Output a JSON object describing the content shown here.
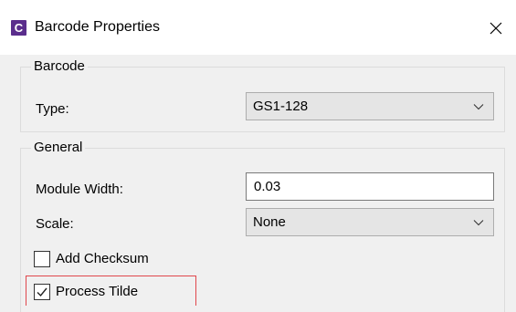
{
  "window": {
    "title": "Barcode Properties",
    "app_icon_letter": "C",
    "close_glyph": "close-icon"
  },
  "barcode_group": {
    "label": "Barcode",
    "type_label": "Type:",
    "type_value": "GS1-128"
  },
  "general_group": {
    "label": "General",
    "module_width_label": "Module Width:",
    "module_width_value": "0.03",
    "scale_label": "Scale:",
    "scale_value": "None",
    "add_checksum_label": "Add Checksum",
    "add_checksum_checked": false,
    "process_tilde_label": "Process Tilde",
    "process_tilde_checked": true
  },
  "colors": {
    "app_icon": "#5a2d8c",
    "highlight": "#e0474c"
  }
}
